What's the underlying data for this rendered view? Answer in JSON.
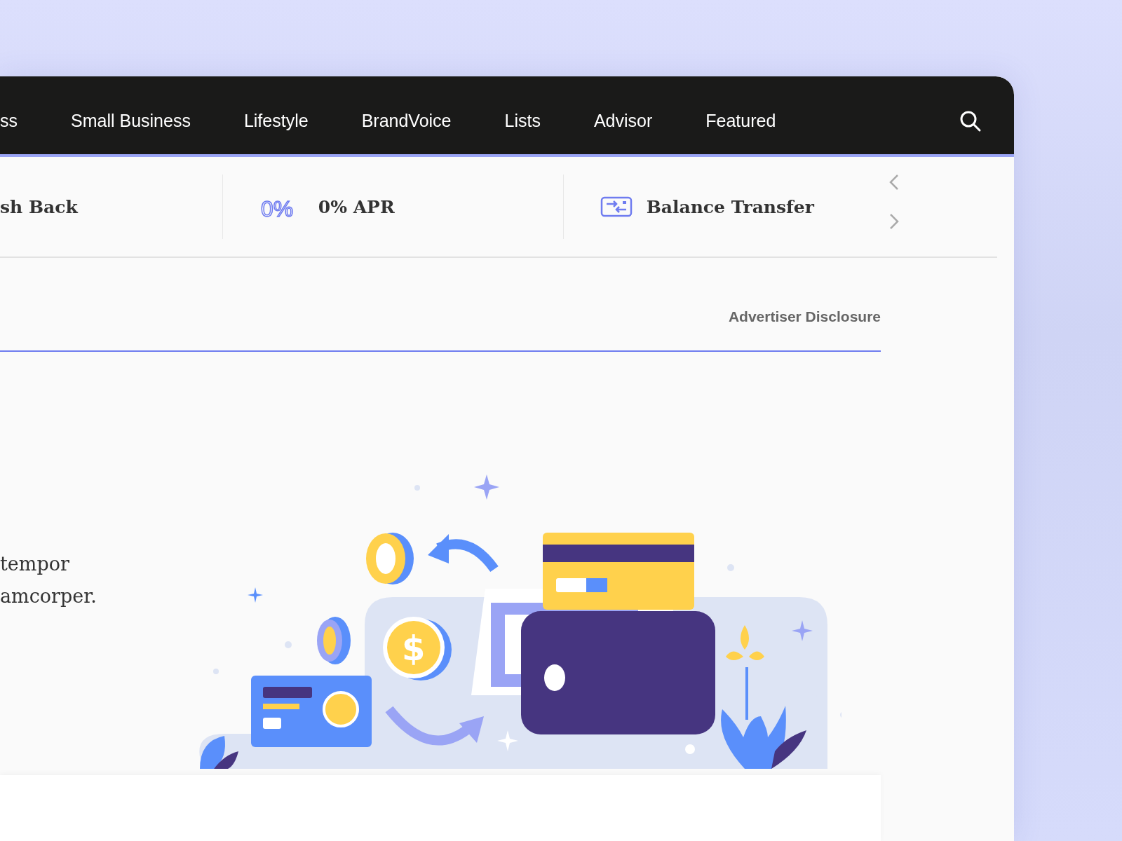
{
  "nav": {
    "items": [
      {
        "label": "ss"
      },
      {
        "label": "Small Business"
      },
      {
        "label": "Lifestyle"
      },
      {
        "label": "BrandVoice"
      },
      {
        "label": "Lists"
      },
      {
        "label": "Advisor"
      },
      {
        "label": "Featured"
      }
    ]
  },
  "categories": {
    "items": [
      {
        "kind": "plain",
        "label": "sh Back"
      },
      {
        "kind": "percent",
        "icon_text": "0%",
        "label": "0% APR"
      },
      {
        "kind": "transfer",
        "label": "Balance Transfer"
      }
    ]
  },
  "disclosure": "Advertiser Disclosure",
  "illustration": {
    "coin_symbol": "$"
  },
  "body_lines": [
    "tempor",
    "amcorper."
  ]
}
